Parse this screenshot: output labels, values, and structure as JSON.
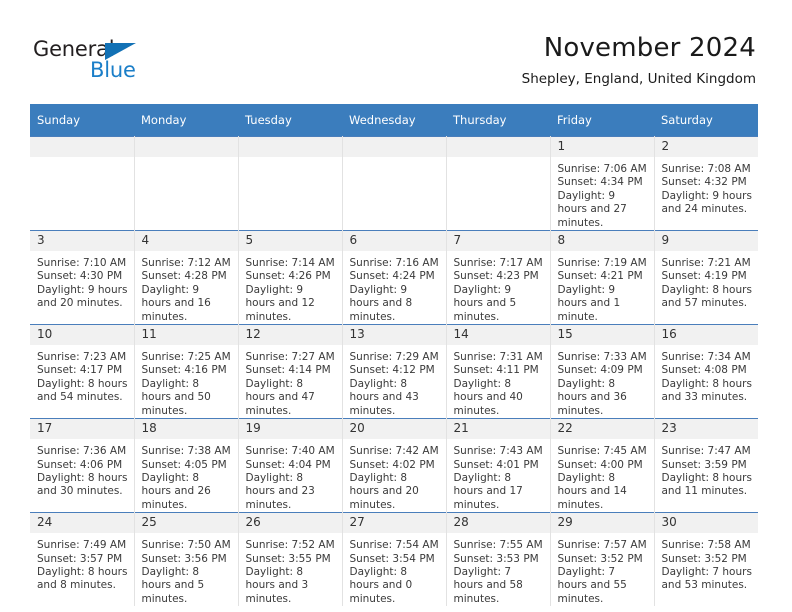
{
  "brand": {
    "name_part1": "General",
    "name_part2": "Blue",
    "accent_color": "#1a7ec8",
    "triangle_color": "#1271b5"
  },
  "header": {
    "month_title": "November 2024",
    "location": "Shepley, England, United Kingdom"
  },
  "calendar": {
    "header_bg": "#3b7dbd",
    "weekdays": [
      "Sunday",
      "Monday",
      "Tuesday",
      "Wednesday",
      "Thursday",
      "Friday",
      "Saturday"
    ],
    "weeks": [
      [
        {
          "day": "",
          "sunrise": "",
          "sunset": "",
          "daylight": "",
          "empty": true
        },
        {
          "day": "",
          "sunrise": "",
          "sunset": "",
          "daylight": "",
          "empty": true
        },
        {
          "day": "",
          "sunrise": "",
          "sunset": "",
          "daylight": "",
          "empty": true
        },
        {
          "day": "",
          "sunrise": "",
          "sunset": "",
          "daylight": "",
          "empty": true
        },
        {
          "day": "",
          "sunrise": "",
          "sunset": "",
          "daylight": "",
          "empty": true
        },
        {
          "day": "1",
          "sunrise": "Sunrise: 7:06 AM",
          "sunset": "Sunset: 4:34 PM",
          "daylight": "Daylight: 9 hours and 27 minutes.",
          "empty": false
        },
        {
          "day": "2",
          "sunrise": "Sunrise: 7:08 AM",
          "sunset": "Sunset: 4:32 PM",
          "daylight": "Daylight: 9 hours and 24 minutes.",
          "empty": false
        }
      ],
      [
        {
          "day": "3",
          "sunrise": "Sunrise: 7:10 AM",
          "sunset": "Sunset: 4:30 PM",
          "daylight": "Daylight: 9 hours and 20 minutes.",
          "empty": false
        },
        {
          "day": "4",
          "sunrise": "Sunrise: 7:12 AM",
          "sunset": "Sunset: 4:28 PM",
          "daylight": "Daylight: 9 hours and 16 minutes.",
          "empty": false
        },
        {
          "day": "5",
          "sunrise": "Sunrise: 7:14 AM",
          "sunset": "Sunset: 4:26 PM",
          "daylight": "Daylight: 9 hours and 12 minutes.",
          "empty": false
        },
        {
          "day": "6",
          "sunrise": "Sunrise: 7:16 AM",
          "sunset": "Sunset: 4:24 PM",
          "daylight": "Daylight: 9 hours and 8 minutes.",
          "empty": false
        },
        {
          "day": "7",
          "sunrise": "Sunrise: 7:17 AM",
          "sunset": "Sunset: 4:23 PM",
          "daylight": "Daylight: 9 hours and 5 minutes.",
          "empty": false
        },
        {
          "day": "8",
          "sunrise": "Sunrise: 7:19 AM",
          "sunset": "Sunset: 4:21 PM",
          "daylight": "Daylight: 9 hours and 1 minute.",
          "empty": false
        },
        {
          "day": "9",
          "sunrise": "Sunrise: 7:21 AM",
          "sunset": "Sunset: 4:19 PM",
          "daylight": "Daylight: 8 hours and 57 minutes.",
          "empty": false
        }
      ],
      [
        {
          "day": "10",
          "sunrise": "Sunrise: 7:23 AM",
          "sunset": "Sunset: 4:17 PM",
          "daylight": "Daylight: 8 hours and 54 minutes.",
          "empty": false
        },
        {
          "day": "11",
          "sunrise": "Sunrise: 7:25 AM",
          "sunset": "Sunset: 4:16 PM",
          "daylight": "Daylight: 8 hours and 50 minutes.",
          "empty": false
        },
        {
          "day": "12",
          "sunrise": "Sunrise: 7:27 AM",
          "sunset": "Sunset: 4:14 PM",
          "daylight": "Daylight: 8 hours and 47 minutes.",
          "empty": false
        },
        {
          "day": "13",
          "sunrise": "Sunrise: 7:29 AM",
          "sunset": "Sunset: 4:12 PM",
          "daylight": "Daylight: 8 hours and 43 minutes.",
          "empty": false
        },
        {
          "day": "14",
          "sunrise": "Sunrise: 7:31 AM",
          "sunset": "Sunset: 4:11 PM",
          "daylight": "Daylight: 8 hours and 40 minutes.",
          "empty": false
        },
        {
          "day": "15",
          "sunrise": "Sunrise: 7:33 AM",
          "sunset": "Sunset: 4:09 PM",
          "daylight": "Daylight: 8 hours and 36 minutes.",
          "empty": false
        },
        {
          "day": "16",
          "sunrise": "Sunrise: 7:34 AM",
          "sunset": "Sunset: 4:08 PM",
          "daylight": "Daylight: 8 hours and 33 minutes.",
          "empty": false
        }
      ],
      [
        {
          "day": "17",
          "sunrise": "Sunrise: 7:36 AM",
          "sunset": "Sunset: 4:06 PM",
          "daylight": "Daylight: 8 hours and 30 minutes.",
          "empty": false
        },
        {
          "day": "18",
          "sunrise": "Sunrise: 7:38 AM",
          "sunset": "Sunset: 4:05 PM",
          "daylight": "Daylight: 8 hours and 26 minutes.",
          "empty": false
        },
        {
          "day": "19",
          "sunrise": "Sunrise: 7:40 AM",
          "sunset": "Sunset: 4:04 PM",
          "daylight": "Daylight: 8 hours and 23 minutes.",
          "empty": false
        },
        {
          "day": "20",
          "sunrise": "Sunrise: 7:42 AM",
          "sunset": "Sunset: 4:02 PM",
          "daylight": "Daylight: 8 hours and 20 minutes.",
          "empty": false
        },
        {
          "day": "21",
          "sunrise": "Sunrise: 7:43 AM",
          "sunset": "Sunset: 4:01 PM",
          "daylight": "Daylight: 8 hours and 17 minutes.",
          "empty": false
        },
        {
          "day": "22",
          "sunrise": "Sunrise: 7:45 AM",
          "sunset": "Sunset: 4:00 PM",
          "daylight": "Daylight: 8 hours and 14 minutes.",
          "empty": false
        },
        {
          "day": "23",
          "sunrise": "Sunrise: 7:47 AM",
          "sunset": "Sunset: 3:59 PM",
          "daylight": "Daylight: 8 hours and 11 minutes.",
          "empty": false
        }
      ],
      [
        {
          "day": "24",
          "sunrise": "Sunrise: 7:49 AM",
          "sunset": "Sunset: 3:57 PM",
          "daylight": "Daylight: 8 hours and 8 minutes.",
          "empty": false
        },
        {
          "day": "25",
          "sunrise": "Sunrise: 7:50 AM",
          "sunset": "Sunset: 3:56 PM",
          "daylight": "Daylight: 8 hours and 5 minutes.",
          "empty": false
        },
        {
          "day": "26",
          "sunrise": "Sunrise: 7:52 AM",
          "sunset": "Sunset: 3:55 PM",
          "daylight": "Daylight: 8 hours and 3 minutes.",
          "empty": false
        },
        {
          "day": "27",
          "sunrise": "Sunrise: 7:54 AM",
          "sunset": "Sunset: 3:54 PM",
          "daylight": "Daylight: 8 hours and 0 minutes.",
          "empty": false
        },
        {
          "day": "28",
          "sunrise": "Sunrise: 7:55 AM",
          "sunset": "Sunset: 3:53 PM",
          "daylight": "Daylight: 7 hours and 58 minutes.",
          "empty": false
        },
        {
          "day": "29",
          "sunrise": "Sunrise: 7:57 AM",
          "sunset": "Sunset: 3:52 PM",
          "daylight": "Daylight: 7 hours and 55 minutes.",
          "empty": false
        },
        {
          "day": "30",
          "sunrise": "Sunrise: 7:58 AM",
          "sunset": "Sunset: 3:52 PM",
          "daylight": "Daylight: 7 hours and 53 minutes.",
          "empty": false
        }
      ]
    ]
  }
}
